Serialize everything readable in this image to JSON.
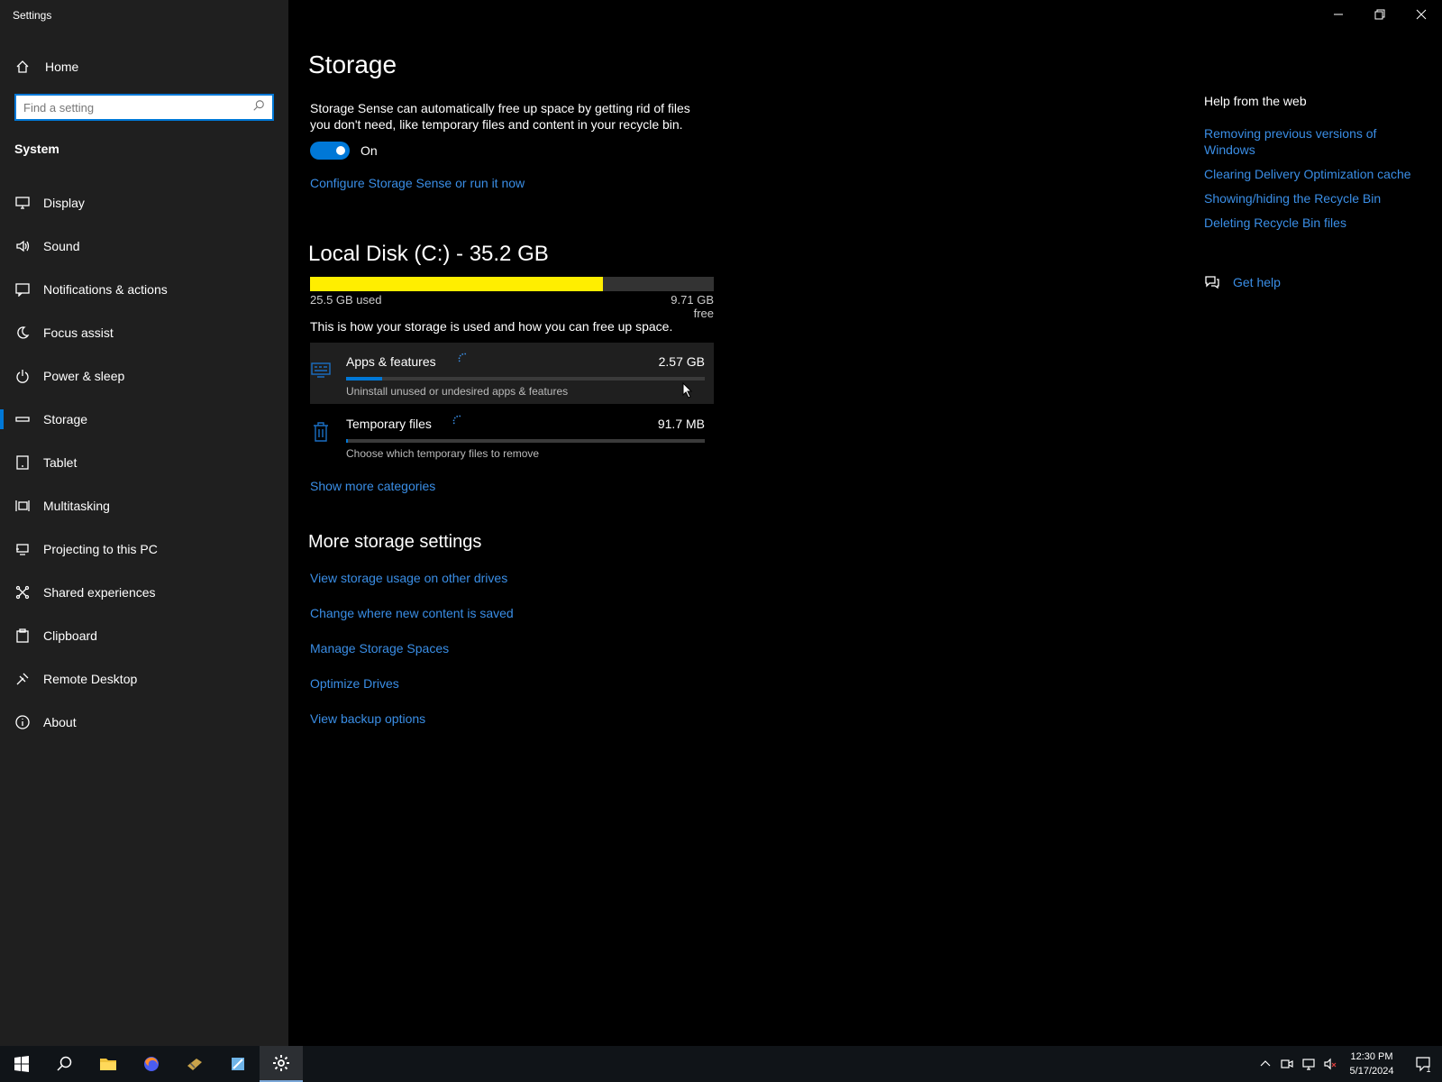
{
  "app": {
    "title": "Settings"
  },
  "sidebar": {
    "home_label": "Home",
    "search_placeholder": "Find a setting",
    "section_label": "System",
    "items": [
      {
        "label": "Display",
        "icon": "monitor-icon"
      },
      {
        "label": "Sound",
        "icon": "speaker-icon"
      },
      {
        "label": "Notifications & actions",
        "icon": "message-icon"
      },
      {
        "label": "Focus assist",
        "icon": "moon-icon"
      },
      {
        "label": "Power & sleep",
        "icon": "power-icon"
      },
      {
        "label": "Storage",
        "icon": "drive-icon",
        "selected": true
      },
      {
        "label": "Tablet",
        "icon": "tablet-icon"
      },
      {
        "label": "Multitasking",
        "icon": "multitask-icon"
      },
      {
        "label": "Projecting to this PC",
        "icon": "project-icon"
      },
      {
        "label": "Shared experiences",
        "icon": "share-icon"
      },
      {
        "label": "Clipboard",
        "icon": "clipboard-icon"
      },
      {
        "label": "Remote Desktop",
        "icon": "remote-icon"
      },
      {
        "label": "About",
        "icon": "info-icon"
      }
    ]
  },
  "main": {
    "title": "Storage",
    "storage_sense_desc": "Storage Sense can automatically free up space by getting rid of files you don't need, like temporary files and content in your recycle bin.",
    "toggle_state_label": "On",
    "toggle_on": true,
    "configure_link": "Configure Storage Sense or run it now",
    "disk": {
      "title": "Local Disk (C:) - 35.2 GB",
      "used_label": "25.5 GB used",
      "free_label": "9.71 GB free",
      "used_fraction": 0.725
    },
    "usage_desc": "This is how your storage is used and how you can free up space.",
    "categories": [
      {
        "name": "Apps & features",
        "size": "2.57 GB",
        "description": "Uninstall unused or undesired apps & features",
        "fill_fraction": 0.1,
        "icon": "apps-icon"
      },
      {
        "name": "Temporary files",
        "size": "91.7 MB",
        "description": "Choose which temporary files to remove",
        "fill_fraction": 0.004,
        "icon": "trash-icon"
      }
    ],
    "show_more_link": "Show more categories",
    "more_settings": {
      "title": "More storage settings",
      "links": [
        "View storage usage on other drives",
        "Change where new content is saved",
        "Manage Storage Spaces",
        "Optimize Drives",
        "View backup options"
      ]
    }
  },
  "help": {
    "title": "Help from the web",
    "links": [
      "Removing previous versions of Windows",
      "Clearing Delivery Optimization cache",
      "Showing/hiding the Recycle Bin",
      "Deleting Recycle Bin files"
    ],
    "get_help_label": "Get help"
  },
  "taskbar": {
    "apps": [
      "start-icon",
      "search-icon",
      "file-explorer-icon",
      "firefox-icon",
      "app-icon",
      "app-icon",
      "settings-icon"
    ],
    "time": "12:30 PM",
    "date": "5/17/2024",
    "notification_count": "1"
  },
  "colors": {
    "accent": "#0078d7",
    "link": "#3a8ee6",
    "disk_fill": "#ffee00"
  }
}
